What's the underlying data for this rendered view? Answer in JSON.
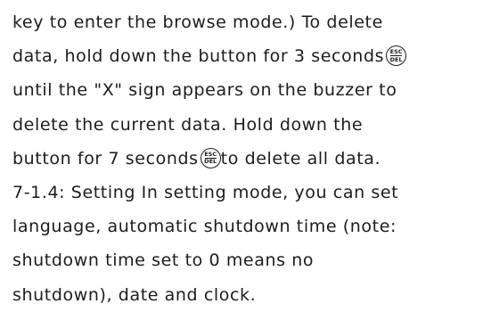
{
  "manual": {
    "lines": [
      {
        "text": "key to enter the browse mode.) To delete"
      },
      {
        "text": "data, hold down the button for 3 seconds",
        "icon": "esc-del-button-icon"
      },
      {
        "text": "until the \"X\" sign appears on the buzzer to"
      },
      {
        "text": "delete the current data. Hold down the"
      },
      {
        "text": "button for 7 seconds",
        "icon": "esc-del-button-icon",
        "after": "to delete all data."
      },
      {
        "text": "7-1.4: Setting In setting mode, you can set"
      },
      {
        "text": "language, automatic shutdown time (note:"
      },
      {
        "text": "shutdown time set to 0 means no"
      },
      {
        "text": "shutdown), date and clock."
      }
    ],
    "icon": {
      "name": "esc-del-button-icon",
      "top_label": "ESC",
      "bottom_label": "DEL"
    }
  }
}
